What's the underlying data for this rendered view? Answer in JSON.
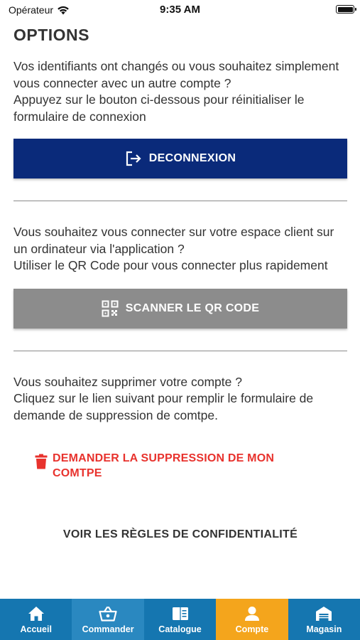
{
  "status_bar": {
    "carrier": "Opérateur",
    "time": "9:35 AM",
    "icons": [
      "wifi-icon",
      "battery-icon"
    ]
  },
  "page": {
    "title": "OPTIONS"
  },
  "section_logout": {
    "text": "Vos identifiants ont changés ou vous souhaitez simplement vous connecter avec un autre compte ?\nAppuyez sur le bouton ci-dessous pour réinitialiser le formulaire de connexion",
    "button_label": "DECONNEXION",
    "button_icon": "logout-icon",
    "button_color": "#0a2a7a"
  },
  "section_qr": {
    "text": "Vous souhaitez vous connecter sur votre espace client sur un ordinateur via l'application ?\nUtiliser le QR Code pour vous connecter plus rapidement",
    "button_label": "SCANNER LE QR CODE",
    "button_icon": "qr-code-icon",
    "button_color": "#8c8c8c"
  },
  "section_delete": {
    "text": "Vous souhaitez supprimer votre compte ?\nCliquez sur le lien suivant pour remplir le formulaire de demande de suppression de comtpe.",
    "link_label": "DEMANDER LA SUPPRESSION DE MON COMTPE",
    "link_icon": "trash-icon",
    "link_color": "#e8322d"
  },
  "privacy_link": "VOIR LES RÈGLES DE CONFIDENTIALITÉ",
  "tab_bar": {
    "items": [
      {
        "label": "Accueil",
        "icon": "home-icon",
        "active": false
      },
      {
        "label": "Commander",
        "icon": "basket-icon",
        "active": false
      },
      {
        "label": "Catalogue",
        "icon": "catalog-icon",
        "active": false
      },
      {
        "label": "Compte",
        "icon": "user-icon",
        "active": true
      },
      {
        "label": "Magasin",
        "icon": "store-icon",
        "active": false
      }
    ],
    "active_color": "#f4a51c",
    "base_color": "#1576b0"
  }
}
